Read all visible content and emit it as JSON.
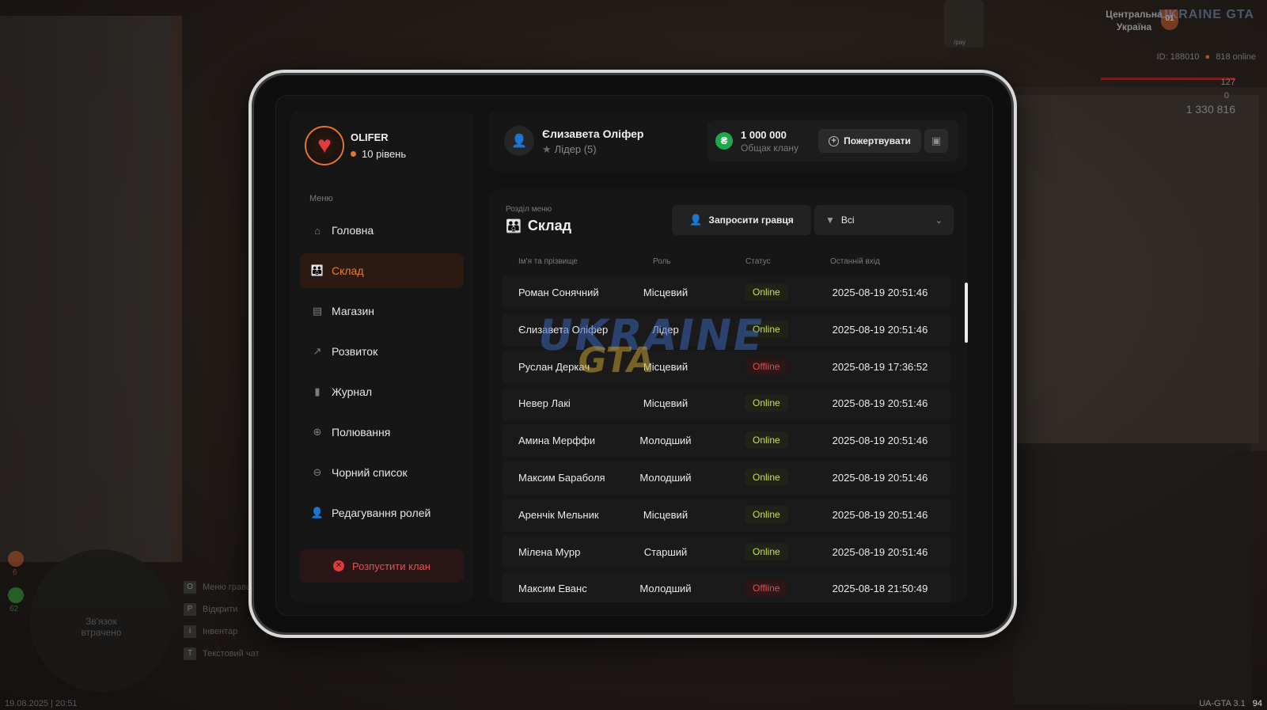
{
  "hud": {
    "region_line1": "Центральна",
    "region_line2": "Україна",
    "region_badge": "01",
    "server_logo": "UKRAINE GTA",
    "player_id": "ID: 188010",
    "online": "818 online",
    "health": "127",
    "armor": "0",
    "money": "1 330 816",
    "car_label": "/pay",
    "minimap_line1": "Зв'язок",
    "minimap_line2": "втрачено",
    "hints": [
      {
        "key": "O",
        "label": "Меню гравця"
      },
      {
        "key": "P",
        "label": "Відкрити"
      },
      {
        "key": "I",
        "label": "Інвентар"
      },
      {
        "key": "T",
        "label": "Текстовий чат"
      }
    ],
    "date_time": "19.08.2025 | 20:51",
    "version": "UA-GTA 3.1",
    "fps": "94",
    "stat1": "6",
    "stat2": "62"
  },
  "sidebar": {
    "clan_name": "OLIFER",
    "clan_level": "10 рівень",
    "menu_title": "Меню",
    "items": [
      {
        "label": "Головна",
        "icon": "home-icon"
      },
      {
        "label": "Склад",
        "icon": "members-icon",
        "active": true
      },
      {
        "label": "Магазин",
        "icon": "shop-icon"
      },
      {
        "label": "Розвиток",
        "icon": "chart-icon"
      },
      {
        "label": "Журнал",
        "icon": "book-icon"
      },
      {
        "label": "Полювання",
        "icon": "crosshair-icon"
      },
      {
        "label": "Чорний список",
        "icon": "block-icon"
      },
      {
        "label": "Редагування ролей",
        "icon": "user-edit-icon"
      }
    ],
    "disband_label": "Розпустити клан"
  },
  "header": {
    "user_name": "Єлизавета Оліфер",
    "user_role": "Лідер (5)",
    "bank_amount": "1 000 000",
    "bank_label": "Общак клану",
    "donate_label": "Пожертвувати"
  },
  "content": {
    "section_label": "Розділ меню",
    "section_title": "Склад",
    "invite_label": "Запросити гравця",
    "filter_value": "Всі",
    "columns": {
      "name": "Ім'я та прізвище",
      "role": "Роль",
      "status": "Статус",
      "last_login": "Останній вхід"
    },
    "rows": [
      {
        "name": "Роман Сонячний",
        "role": "Місцевий",
        "status": "Online",
        "last": "2025-08-19 20:51:46"
      },
      {
        "name": "Єлизавета Оліфер",
        "role": "Лідер",
        "status": "Online",
        "last": "2025-08-19 20:51:46"
      },
      {
        "name": "Руслан Деркач",
        "role": "Місцевий",
        "status": "Offline",
        "last": "2025-08-19 17:36:52"
      },
      {
        "name": "Невер Лакі",
        "role": "Місцевий",
        "status": "Online",
        "last": "2025-08-19 20:51:46"
      },
      {
        "name": "Амина Мерффи",
        "role": "Молодший",
        "status": "Online",
        "last": "2025-08-19 20:51:46"
      },
      {
        "name": "Максим Бараболя",
        "role": "Молодший",
        "status": "Online",
        "last": "2025-08-19 20:51:46"
      },
      {
        "name": "Аренчік Мельник",
        "role": "Місцевий",
        "status": "Online",
        "last": "2025-08-19 20:51:46"
      },
      {
        "name": "Мілена Мурр",
        "role": "Старший",
        "status": "Online",
        "last": "2025-08-19 20:51:46"
      },
      {
        "name": "Максим Еванс",
        "role": "Молодший",
        "status": "Offline",
        "last": "2025-08-18 21:50:49"
      }
    ]
  },
  "watermark": {
    "line1": "UKRAINE",
    "line2": "GTA"
  },
  "colors": {
    "accent": "#f07c2a",
    "online": "#c7e04d",
    "offline": "#e24c4c",
    "bank": "#1fa84a"
  }
}
